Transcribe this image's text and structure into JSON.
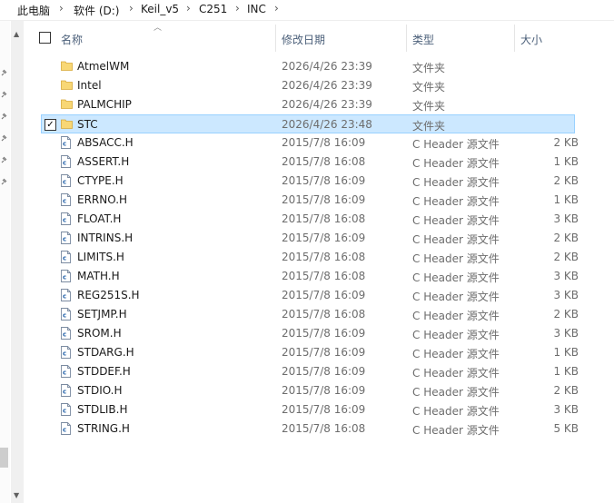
{
  "breadcrumb": {
    "items": [
      "此电脑",
      "软件 (D:)",
      "Keil_v5",
      "C251",
      "INC"
    ],
    "separator": "›"
  },
  "columns": {
    "name": "名称",
    "date": "修改日期",
    "type": "类型",
    "size": "大小"
  },
  "rows": [
    {
      "name": "AtmelWM",
      "date": "2026/4/26 23:39",
      "type": "文件夹",
      "size": "",
      "kind": "folder-icon"
    },
    {
      "name": "Intel",
      "date": "2026/4/26 23:39",
      "type": "文件夹",
      "size": "",
      "kind": "folder-icon"
    },
    {
      "name": "PALMCHIP",
      "date": "2026/4/26 23:39",
      "type": "文件夹",
      "size": "",
      "kind": "folder-icon"
    },
    {
      "name": "STC",
      "date": "2026/4/26 23:48",
      "type": "文件夹",
      "size": "",
      "kind": "folder-icon",
      "selected": true,
      "checkmark": "✓"
    },
    {
      "name": "ABSACC.H",
      "date": "2015/7/8 16:09",
      "type": "C Header 源文件",
      "size": "2 KB",
      "kind": "c-header-file-icon"
    },
    {
      "name": "ASSERT.H",
      "date": "2015/7/8 16:08",
      "type": "C Header 源文件",
      "size": "1 KB",
      "kind": "c-header-file-icon"
    },
    {
      "name": "CTYPE.H",
      "date": "2015/7/8 16:09",
      "type": "C Header 源文件",
      "size": "2 KB",
      "kind": "c-header-file-icon"
    },
    {
      "name": "ERRNO.H",
      "date": "2015/7/8 16:09",
      "type": "C Header 源文件",
      "size": "1 KB",
      "kind": "c-header-file-icon"
    },
    {
      "name": "FLOAT.H",
      "date": "2015/7/8 16:08",
      "type": "C Header 源文件",
      "size": "3 KB",
      "kind": "c-header-file-icon"
    },
    {
      "name": "INTRINS.H",
      "date": "2015/7/8 16:09",
      "type": "C Header 源文件",
      "size": "2 KB",
      "kind": "c-header-file-icon"
    },
    {
      "name": "LIMITS.H",
      "date": "2015/7/8 16:08",
      "type": "C Header 源文件",
      "size": "2 KB",
      "kind": "c-header-file-icon"
    },
    {
      "name": "MATH.H",
      "date": "2015/7/8 16:08",
      "type": "C Header 源文件",
      "size": "3 KB",
      "kind": "c-header-file-icon"
    },
    {
      "name": "REG251S.H",
      "date": "2015/7/8 16:09",
      "type": "C Header 源文件",
      "size": "3 KB",
      "kind": "c-header-file-icon"
    },
    {
      "name": "SETJMP.H",
      "date": "2015/7/8 16:08",
      "type": "C Header 源文件",
      "size": "2 KB",
      "kind": "c-header-file-icon"
    },
    {
      "name": "SROM.H",
      "date": "2015/7/8 16:09",
      "type": "C Header 源文件",
      "size": "3 KB",
      "kind": "c-header-file-icon"
    },
    {
      "name": "STDARG.H",
      "date": "2015/7/8 16:09",
      "type": "C Header 源文件",
      "size": "1 KB",
      "kind": "c-header-file-icon"
    },
    {
      "name": "STDDEF.H",
      "date": "2015/7/8 16:09",
      "type": "C Header 源文件",
      "size": "1 KB",
      "kind": "c-header-file-icon"
    },
    {
      "name": "STDIO.H",
      "date": "2015/7/8 16:09",
      "type": "C Header 源文件",
      "size": "2 KB",
      "kind": "c-header-file-icon"
    },
    {
      "name": "STDLIB.H",
      "date": "2015/7/8 16:09",
      "type": "C Header 源文件",
      "size": "3 KB",
      "kind": "c-header-file-icon"
    },
    {
      "name": "STRING.H",
      "date": "2015/7/8 16:08",
      "type": "C Header 源文件",
      "size": "5 KB",
      "kind": "c-header-file-icon"
    }
  ],
  "colors": {
    "selected_bg": "#cce8ff",
    "selected_border": "#99d1ff",
    "folder": "#f8d775",
    "header_text": "#4c607a"
  }
}
